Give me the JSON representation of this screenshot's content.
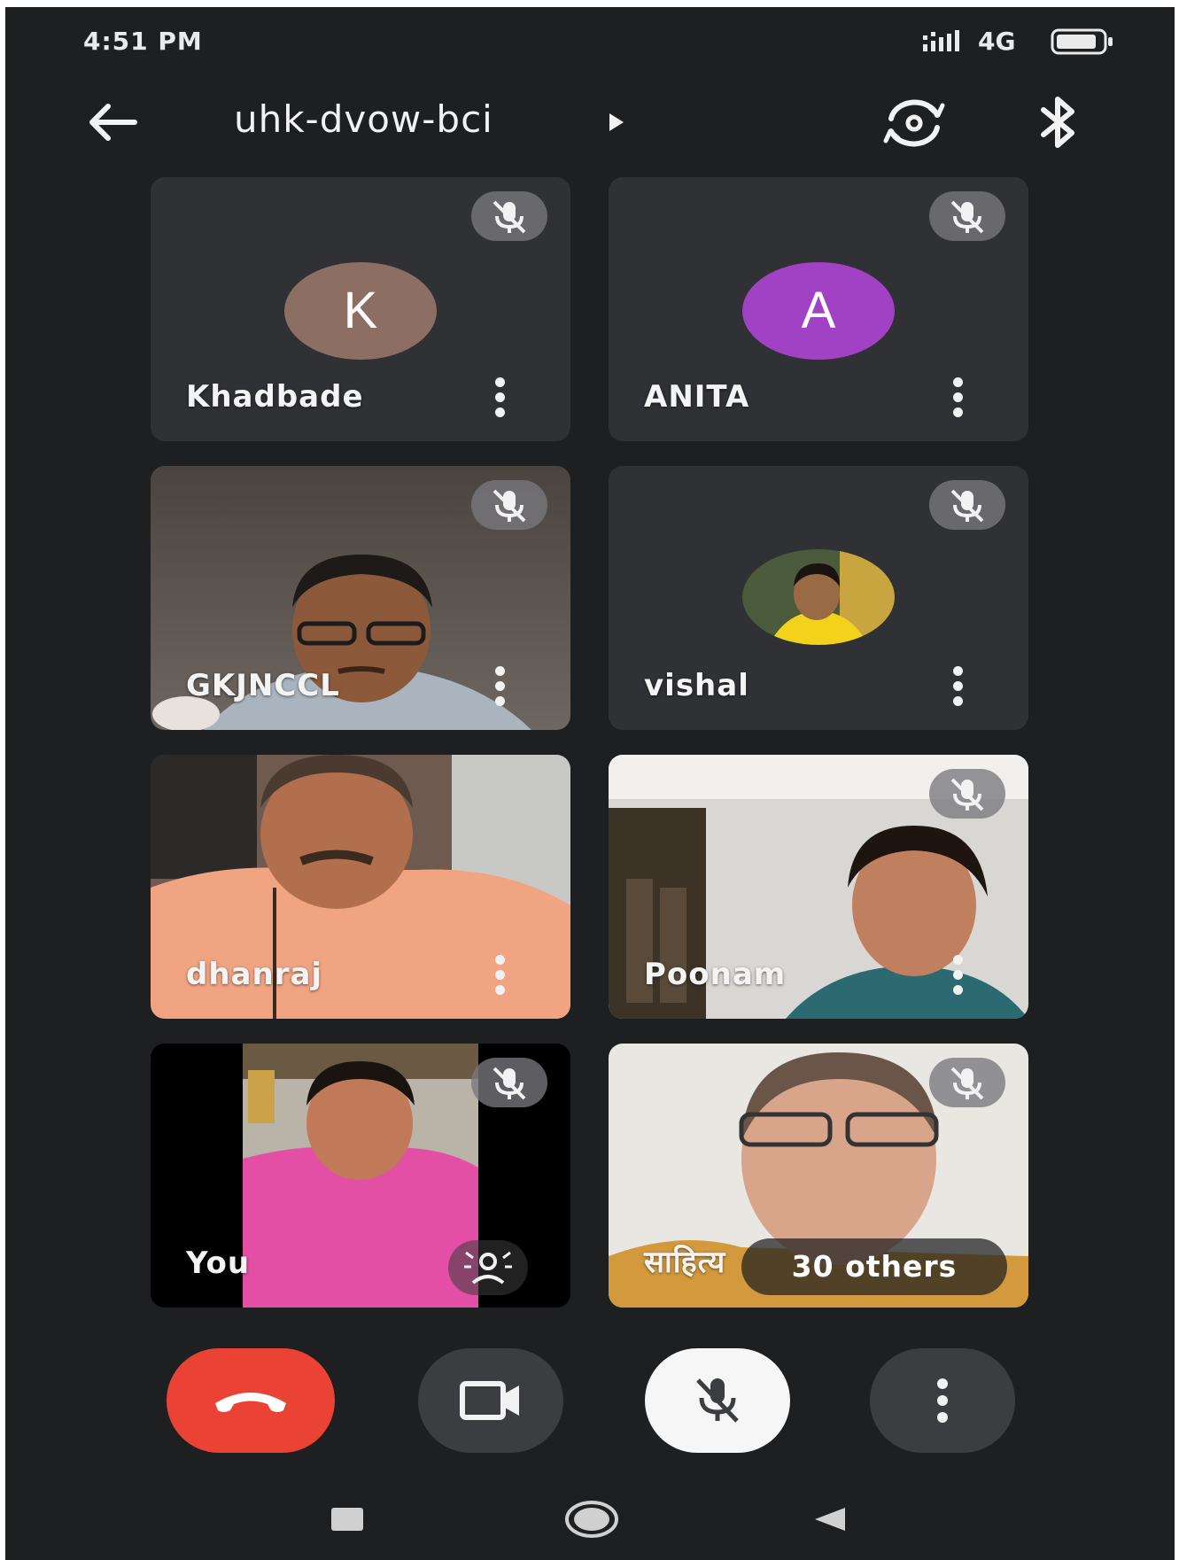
{
  "status_bar": {
    "time": "4:51 PM",
    "network": "4G",
    "icons": [
      "signal-bars-icon",
      "battery-icon"
    ]
  },
  "header": {
    "meeting_code": "uhk-dvow-bci",
    "icons": [
      "back-arrow-icon",
      "play-triangle-icon",
      "switch-camera-icon",
      "bluetooth-icon"
    ]
  },
  "participants": [
    {
      "name": "Khadbade",
      "avatar_letter": "K",
      "avatar_color": "#8d6e63",
      "muted": true,
      "video": false
    },
    {
      "name": "ANITA",
      "avatar_letter": "A",
      "avatar_color": "#a142c4",
      "muted": true,
      "video": false
    },
    {
      "name": "GKJNCCL",
      "muted": true,
      "video": true
    },
    {
      "name": "vishal",
      "muted": true,
      "video": false,
      "avatar_photo": true
    },
    {
      "name": "dhanraj",
      "muted": false,
      "video": true
    },
    {
      "name": "Poonam",
      "muted": true,
      "video": true
    },
    {
      "name": "You",
      "muted": true,
      "video": true,
      "self": true
    },
    {
      "name": "साहित्य",
      "muted": true,
      "video": true
    }
  ],
  "others_chip": "30 others",
  "controls": {
    "end_call_color": "#ea4335",
    "buttons": [
      "end-call-button",
      "camera-toggle-button",
      "mic-toggle-button",
      "more-options-button"
    ]
  },
  "nav_bar": [
    "recent-apps-icon",
    "home-icon",
    "back-icon"
  ]
}
